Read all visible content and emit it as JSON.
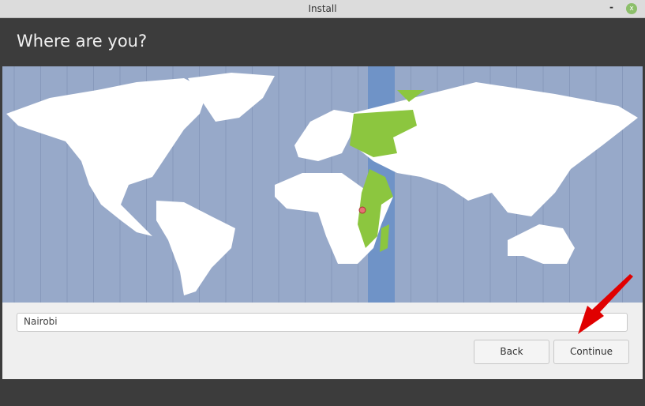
{
  "window": {
    "title": "Install",
    "minimize": "-",
    "close": "x"
  },
  "page": {
    "heading": "Where are you?"
  },
  "map": {
    "selected_city": "Nairobi",
    "highlight_color": "#8cc63f",
    "zone_color": "#6f93c7",
    "water_color": "#97a9c9"
  },
  "location_input": {
    "value": "Nairobi"
  },
  "buttons": {
    "back": "Back",
    "continue": "Continue"
  },
  "annotation": {
    "arrow_color": "#e00000"
  }
}
